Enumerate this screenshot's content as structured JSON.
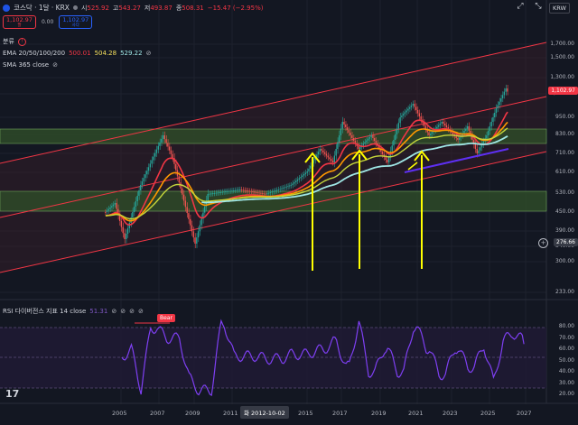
{
  "header": {
    "symbol_title": "코스닥 · 1달 · KRX",
    "open_label": "시",
    "open_value": "525.92",
    "high_label": "고",
    "high_value": "543.27",
    "low_label": "저",
    "low_value": "493.87",
    "close_label": "종",
    "close_value": "508.31",
    "change": "−15.47 (−2.95%)",
    "sell_price": "1,102.97",
    "sell_label": "팔",
    "spread": "0.00",
    "buy_price": "1,102.97",
    "buy_label": "사다",
    "split_label": "분류",
    "ema_label": "EMA 20/50/100/200",
    "ema_values": [
      "500.01",
      "504.28",
      "529.22"
    ],
    "sma_label": "SMA 365 close",
    "currency": "KRW"
  },
  "price_axis": [
    {
      "label": "1,700.00"
    },
    {
      "label": "1,500.00"
    },
    {
      "label": "1,300.00"
    },
    {
      "label": "1,100.00"
    },
    {
      "label": "950.00"
    },
    {
      "label": "830.00"
    },
    {
      "label": "710.00"
    },
    {
      "label": "610.00"
    },
    {
      "label": "530.00"
    },
    {
      "label": "450.00"
    },
    {
      "label": "390.00"
    },
    {
      "label": "340.00"
    },
    {
      "label": "300.00"
    },
    {
      "label": "233.00"
    }
  ],
  "price_tags": {
    "last": "1,102.97",
    "crosshair": "276.66"
  },
  "rsi": {
    "label": "RSI 다이버전스 지표 14 close",
    "value": "51.31",
    "bear_label": "Bear",
    "axis": [
      "80.00",
      "70.00",
      "60.00",
      "50.00",
      "40.00",
      "30.00",
      "20.00"
    ]
  },
  "time_axis": {
    "labels": [
      "2005",
      "2007",
      "2009",
      "2011",
      "2015",
      "2017",
      "2019",
      "2021",
      "2023",
      "2025",
      "2027"
    ],
    "crosshair_date": "화 2012-10-02"
  },
  "toolbar": {
    "expand_icon": "expand-icon",
    "shrink_icon": "shrink-icon"
  },
  "logo": "17",
  "colors": {
    "bg": "#131722",
    "up": "#26a69a",
    "down": "#ef5350",
    "channel": "#f23645",
    "zone_fill": "#2e4a28",
    "arrow": "#ffff00",
    "rsi": "#7e3ff2",
    "ema20": "#f23645",
    "ema50": "#ff9800",
    "ema100": "#c6d63b",
    "ema200": "#9fe7e6",
    "support": "#5e2ff2"
  }
}
